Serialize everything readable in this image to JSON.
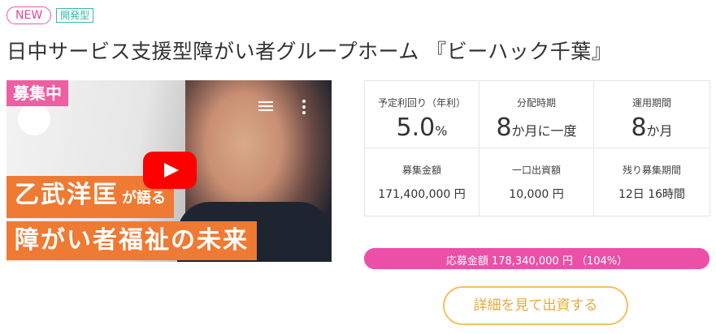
{
  "badges": {
    "new": "NEW",
    "type": "開発型"
  },
  "title": "日中サービス支援型障がい者グループホーム 『ビーハック千葉』",
  "video": {
    "status": "募集中",
    "caption_name": "乙武洋匡",
    "caption_verb": "が語る",
    "caption_line2": "障がい者福祉の未来"
  },
  "stats": [
    {
      "label": "予定利回り（年利）",
      "value": "5.0",
      "unit": "%"
    },
    {
      "label": "分配時期",
      "value": "8",
      "unit": "か月に一度"
    },
    {
      "label": "運用期間",
      "value": "8",
      "unit": "か月"
    },
    {
      "label": "募集金額",
      "text": "171,400,000 円"
    },
    {
      "label": "一口出資額",
      "text": "10,000 円"
    },
    {
      "label": "残り募集期間",
      "text": "12日 16時間"
    }
  ],
  "progress": {
    "text": "応募金額 178,340,000 円 （104%）",
    "percent": 104
  },
  "detail_button": "詳細を見て出資する",
  "colors": {
    "pink": "#ec5fa3",
    "orange": "#ee7a33",
    "gold": "#f5c160",
    "teal": "#3bb8a8"
  }
}
